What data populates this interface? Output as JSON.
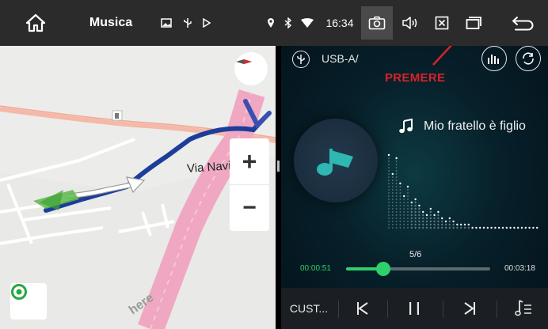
{
  "status_bar": {
    "app_title": "Musica",
    "time": "16:34"
  },
  "map": {
    "street_label": "Via Navicella",
    "zoom_in_label": "+",
    "zoom_out_label": "−",
    "watermark": "here"
  },
  "player": {
    "source": "USB-A/",
    "annotation": "PREMERE",
    "song_title": "Mio fratello è figlio",
    "track_counter": "5/6",
    "elapsed": "00:00:51",
    "total": "00:03:18",
    "progress": 0.257,
    "custom_label": "CUST...",
    "accent_color": "#2fd06a"
  }
}
